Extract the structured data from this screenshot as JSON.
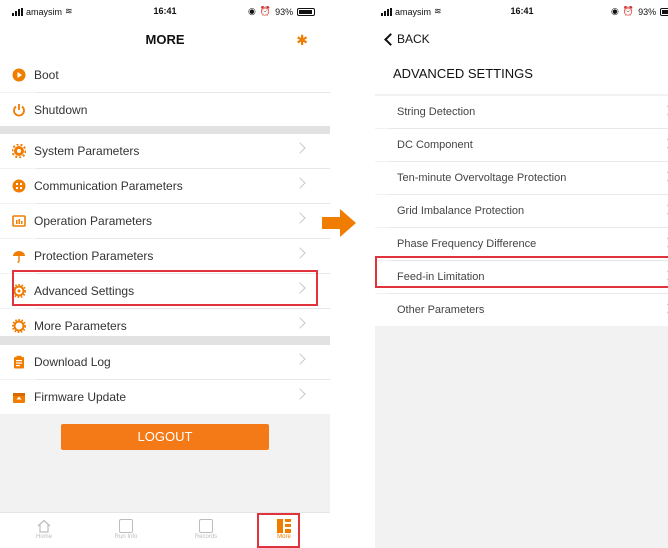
{
  "colors": {
    "accent": "#f07c00",
    "highlight": "#e0333b",
    "logout_bg": "#f37a16"
  },
  "left_screen": {
    "status": {
      "carrier": "amaysim",
      "time": "16:41",
      "battery": "93%"
    },
    "title": "MORE",
    "items": [
      {
        "label": "Boot",
        "icon": "power-on-icon"
      },
      {
        "label": "Shutdown",
        "icon": "power-icon"
      },
      {
        "label": "System Parameters",
        "icon": "gear-icon"
      },
      {
        "label": "Communication Parameters",
        "icon": "communication-icon"
      },
      {
        "label": "Operation Parameters",
        "icon": "operation-icon"
      },
      {
        "label": "Protection Parameters",
        "icon": "umbrella-icon"
      },
      {
        "label": "Advanced Settings",
        "icon": "advanced-gear-icon"
      },
      {
        "label": "More Parameters",
        "icon": "more-gear-icon"
      },
      {
        "label": "Download Log",
        "icon": "clipboard-icon"
      },
      {
        "label": "Firmware Update",
        "icon": "upgrade-icon"
      }
    ],
    "logout": "LOGOUT",
    "tabs": [
      {
        "label": "Home",
        "icon": "home-icon"
      },
      {
        "label": "Run Info",
        "icon": "monitor-icon"
      },
      {
        "label": "Records",
        "icon": "records-icon"
      },
      {
        "label": "More",
        "icon": "more-grid-icon"
      }
    ]
  },
  "right_screen": {
    "status": {
      "carrier": "amaysim",
      "time": "16:41",
      "battery": "93%"
    },
    "back": "BACK",
    "title": "ADVANCED SETTINGS",
    "items": [
      {
        "label": "String Detection"
      },
      {
        "label": "DC Component"
      },
      {
        "label": "Ten-minute Overvoltage Protection"
      },
      {
        "label": "Grid Imbalance Protection"
      },
      {
        "label": "Phase Frequency Difference"
      },
      {
        "label": "Feed-in Limitation"
      },
      {
        "label": "Other Parameters"
      }
    ]
  }
}
